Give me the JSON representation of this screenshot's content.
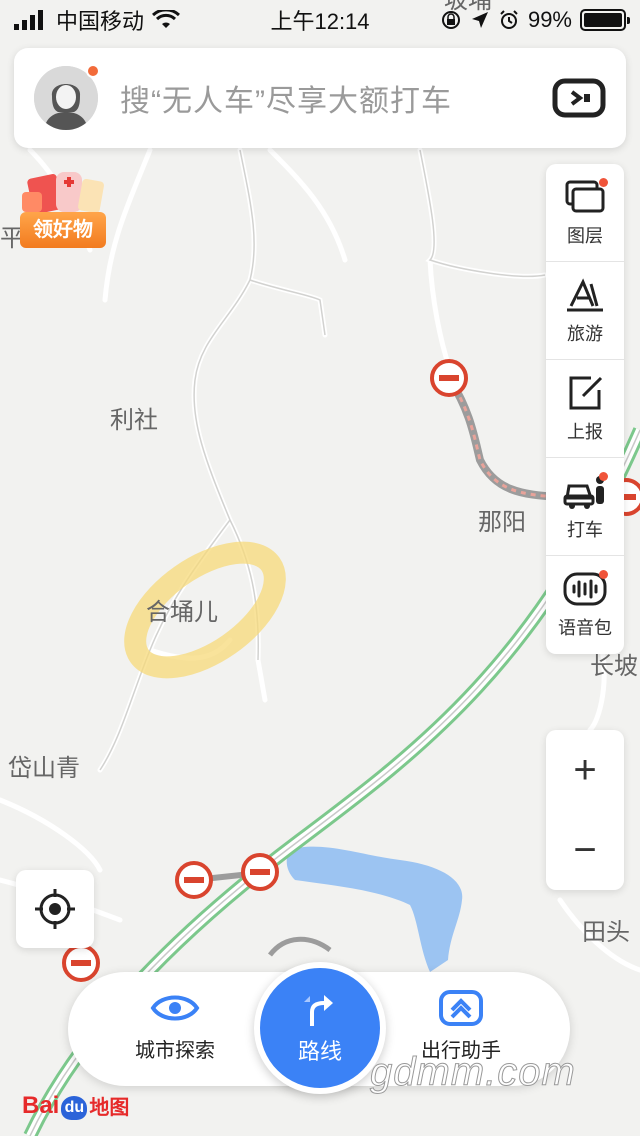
{
  "status_bar": {
    "carrier": "中国移动",
    "time": "上午12:14",
    "battery": "99%",
    "battery_level": 0.99
  },
  "search": {
    "placeholder": "搜“无人车”尽享大额打车"
  },
  "promo": {
    "label": "领好物"
  },
  "map": {
    "labels": {
      "partial_top": "坂埔",
      "partial_left": "平",
      "lishe": "利社",
      "heyonger": "合埇儿",
      "nayang": "那阳",
      "changpo": "长坡",
      "daishanqing": "岱山青",
      "tiantou": "田头"
    }
  },
  "toolbar": {
    "items": [
      {
        "label": "图层",
        "icon": "layers-icon",
        "dot": true
      },
      {
        "label": "旅游",
        "icon": "travel-icon",
        "dot": false
      },
      {
        "label": "上报",
        "icon": "report-icon",
        "dot": false
      },
      {
        "label": "打车",
        "icon": "taxi-icon",
        "dot": true
      },
      {
        "label": "语音包",
        "icon": "voice-pack-icon",
        "dot": true
      }
    ]
  },
  "zoom": {
    "in_label": "+",
    "out_label": "−"
  },
  "bottom_nav": {
    "city_explore": "城市探索",
    "route": "路线",
    "travel_assistant": "出行助手"
  },
  "brand": {
    "bai": "Bai",
    "du": "du",
    "ditu": "地图"
  },
  "watermark": "gdmm.com",
  "colors": {
    "accent_blue": "#3b82f6",
    "highway_green": "#7cc88c",
    "restriction_red": "#d9442e",
    "lake_blue": "#9cc4f2",
    "highlight_yellow": "#f7d97a"
  }
}
